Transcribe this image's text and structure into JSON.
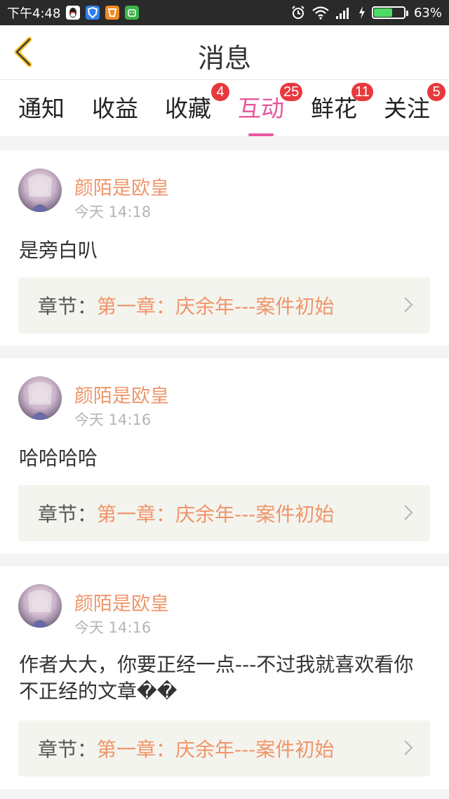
{
  "status_bar": {
    "time": "下午4:48",
    "battery": "63%",
    "battery_level": 0.63,
    "icons": [
      "qq-icon",
      "shield-icon",
      "game-icon",
      "android-icon",
      "alarm-icon",
      "wifi-icon",
      "signal-icon",
      "charging-icon",
      "battery-icon"
    ]
  },
  "header": {
    "title": "消息"
  },
  "tabs": [
    {
      "label": "通知",
      "badge": ""
    },
    {
      "label": "收益",
      "badge": ""
    },
    {
      "label": "收藏",
      "badge": "4"
    },
    {
      "label": "互动",
      "badge": "25",
      "active": true
    },
    {
      "label": "鲜花",
      "badge": "11"
    },
    {
      "label": "关注",
      "badge": "5"
    }
  ],
  "messages": [
    {
      "user": "颜陌是欧皇",
      "time": "今天 14:18",
      "text": "是旁白叭",
      "chapter_label": "章节：",
      "chapter_title": "第一章：庆余年---案件初始"
    },
    {
      "user": "颜陌是欧皇",
      "time": "今天 14:16",
      "text": "哈哈哈哈",
      "chapter_label": "章节：",
      "chapter_title": "第一章：庆余年---案件初始"
    },
    {
      "user": "颜陌是欧皇",
      "time": "今天 14:16",
      "text": "作者大大，你要正经一点---不过我就喜欢看你不正经的文章��",
      "chapter_label": "章节：",
      "chapter_title": "第一章：庆余年---案件初始"
    }
  ],
  "colors": {
    "accent": "#e8579b",
    "username": "#f0956a",
    "badge": "#e7393d",
    "back_arrow": "#f3c428"
  }
}
